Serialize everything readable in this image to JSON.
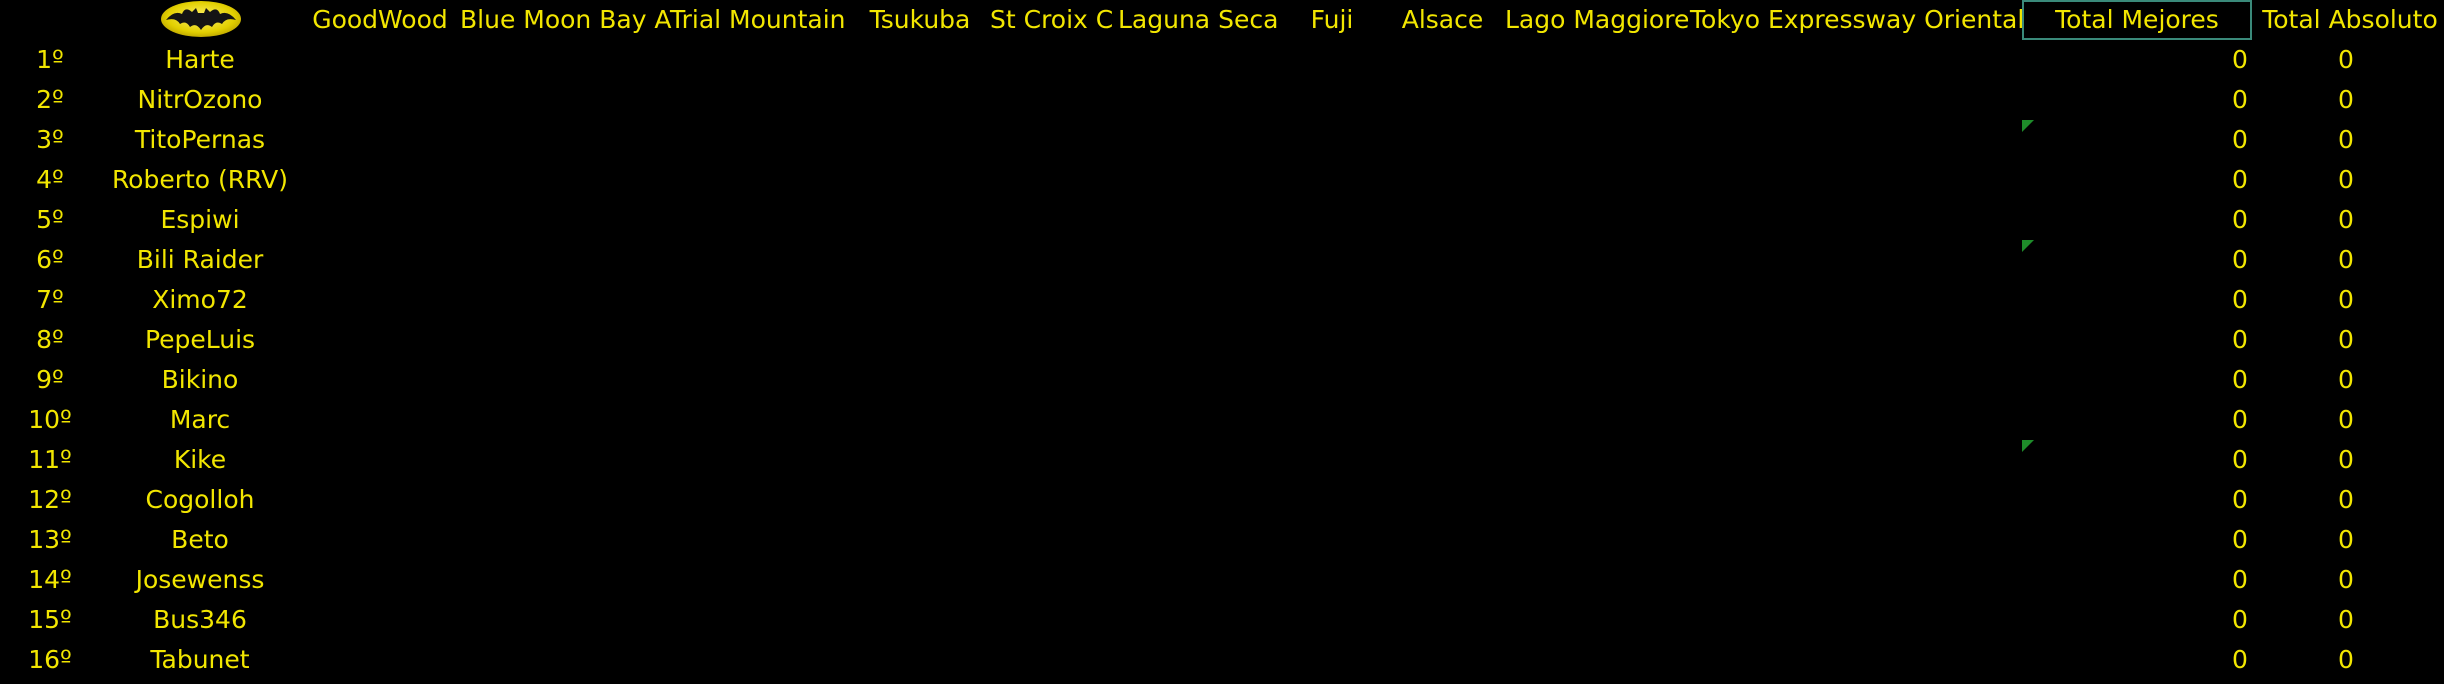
{
  "colors": {
    "background": "#000000",
    "text": "#f2e600",
    "selection_border": "#3a8a7a",
    "comment_flag": "#1e8c2a"
  },
  "logo": {
    "icon": "bat-logo-icon"
  },
  "header": {
    "tracks": [
      "GoodWood",
      "Blue Moon Bay A",
      "Trial Mountain",
      "Tsukuba",
      "St Croix C",
      "Laguna Seca",
      "Fuji",
      "Alsace",
      "Lago Maggiore",
      "Tokyo Expressway Oriental"
    ],
    "total_mejores": "Total Mejores",
    "total_absoluto": "Total Absoluto"
  },
  "rows": [
    {
      "pos": "1º",
      "name": "Harte",
      "total_mejores": "0",
      "total_absoluto": "0"
    },
    {
      "pos": "2º",
      "name": "NitrOzono",
      "total_mejores": "0",
      "total_absoluto": "0"
    },
    {
      "pos": "3º",
      "name": "TitoPernas",
      "total_mejores": "0",
      "total_absoluto": "0"
    },
    {
      "pos": "4º",
      "name": "Roberto (RRV)",
      "total_mejores": "0",
      "total_absoluto": "0"
    },
    {
      "pos": "5º",
      "name": "Espiwi",
      "total_mejores": "0",
      "total_absoluto": "0"
    },
    {
      "pos": "6º",
      "name": "Bili Raider",
      "total_mejores": "0",
      "total_absoluto": "0"
    },
    {
      "pos": "7º",
      "name": "Ximo72",
      "total_mejores": "0",
      "total_absoluto": "0"
    },
    {
      "pos": "8º",
      "name": "PepeLuis",
      "total_mejores": "0",
      "total_absoluto": "0"
    },
    {
      "pos": "9º",
      "name": "Bikino",
      "total_mejores": "0",
      "total_absoluto": "0"
    },
    {
      "pos": "10º",
      "name": "Marc",
      "total_mejores": "0",
      "total_absoluto": "0"
    },
    {
      "pos": "11º",
      "name": "Kike",
      "total_mejores": "0",
      "total_absoluto": "0"
    },
    {
      "pos": "12º",
      "name": "Cogolloh",
      "total_mejores": "0",
      "total_absoluto": "0"
    },
    {
      "pos": "13º",
      "name": "Beto",
      "total_mejores": "0",
      "total_absoluto": "0"
    },
    {
      "pos": "14º",
      "name": "Josewenss",
      "total_mejores": "0",
      "total_absoluto": "0"
    },
    {
      "pos": "15º",
      "name": "Bus346",
      "total_mejores": "0",
      "total_absoluto": "0"
    },
    {
      "pos": "16º",
      "name": "Tabunet",
      "total_mejores": "0",
      "total_absoluto": "0"
    }
  ]
}
